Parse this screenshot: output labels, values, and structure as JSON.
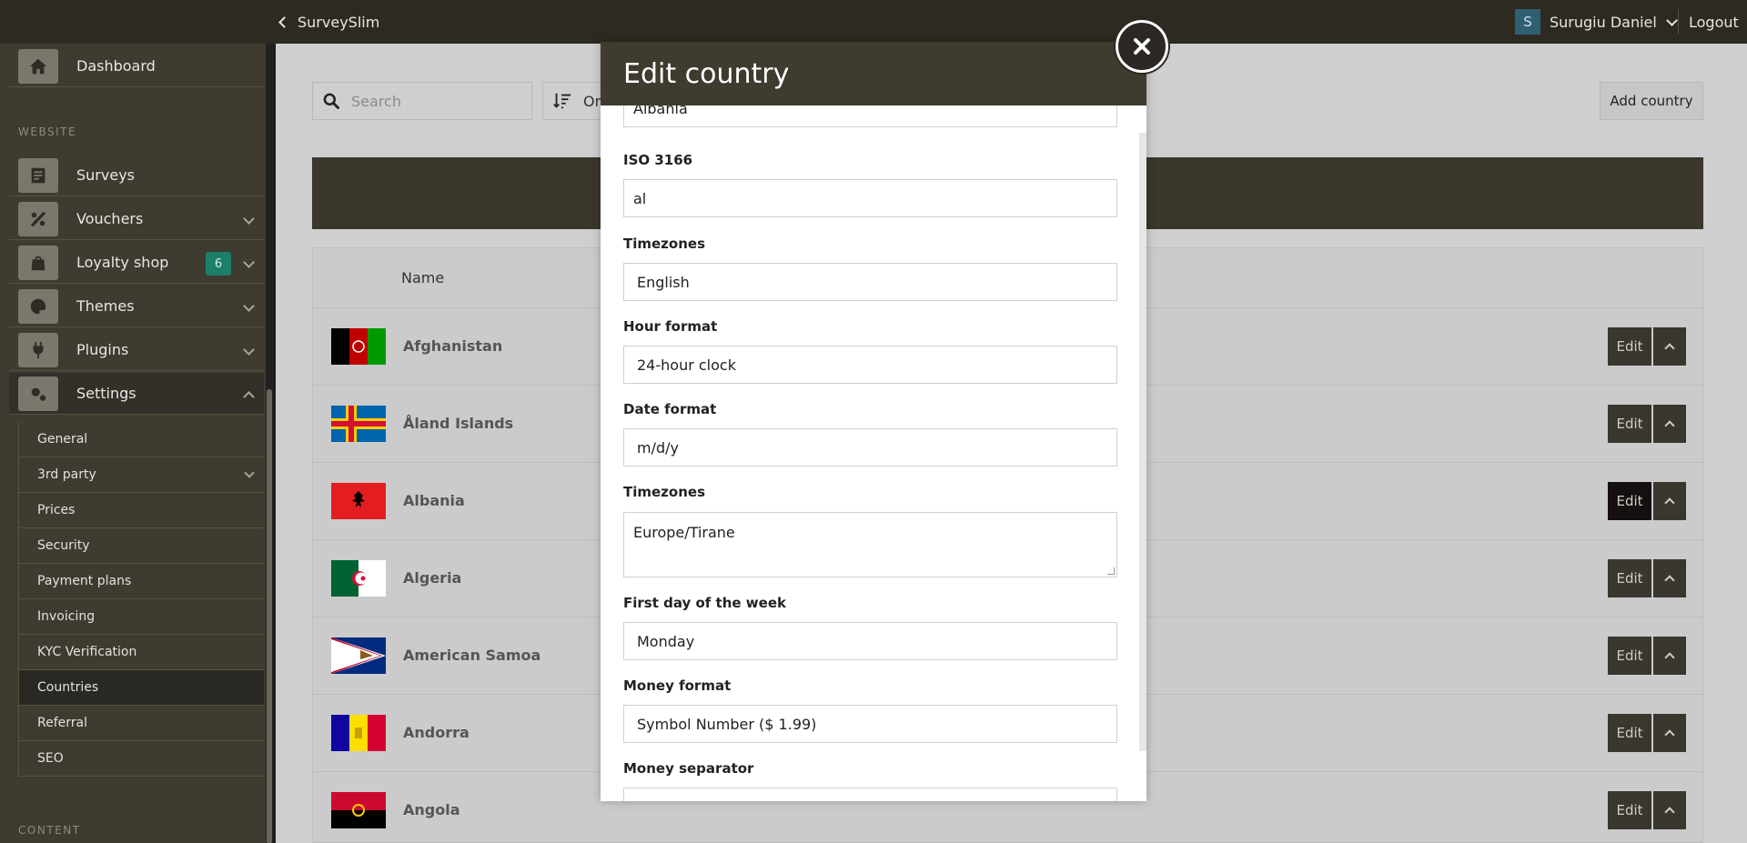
{
  "topbar": {
    "brand": "SurveySlim",
    "user_initial": "S",
    "user_name": "Surugiu Daniel",
    "logout": "Logout"
  },
  "sidebar": {
    "dashboard": "Dashboard",
    "section_website": "WEBSITE",
    "items": [
      {
        "label": "Surveys",
        "icon": "document-icon"
      },
      {
        "label": "Vouchers",
        "icon": "percent-icon"
      },
      {
        "label": "Loyalty shop",
        "icon": "shopping-bag-icon",
        "badge": "6"
      },
      {
        "label": "Themes",
        "icon": "palette-icon"
      },
      {
        "label": "Plugins",
        "icon": "plug-icon"
      },
      {
        "label": "Settings",
        "icon": "gears-icon"
      }
    ],
    "settings_sub": [
      "General",
      "3rd party",
      "Prices",
      "Security",
      "Payment plans",
      "Invoicing",
      "KYC Verification",
      "Countries",
      "Referral",
      "SEO"
    ],
    "section_content": "CONTENT"
  },
  "main": {
    "search_placeholder": "Search",
    "order_label": "Or",
    "add_country": "Add country",
    "column_name": "Name",
    "edit_label": "Edit",
    "countries": [
      "Afghanistan",
      "Åland Islands",
      "Albania",
      "Algeria",
      "American Samoa",
      "Andorra",
      "Angola"
    ]
  },
  "modal": {
    "title": "Edit country",
    "name_value": "Albania",
    "iso_label": "ISO 3166",
    "iso_value": "al",
    "languages_label": "Timezones",
    "languages_value": "English",
    "hour_label": "Hour format",
    "hour_value": "24-hour clock",
    "date_label": "Date format",
    "date_value": "m/d/y",
    "tz_label": "Timezones",
    "tz_value": "Europe/Tirane",
    "week_label": "First day of the week",
    "week_value": "Monday",
    "money_format_label": "Money format",
    "money_format_value": "Symbol Number ($ 1.99)",
    "money_sep_label": "Money separator"
  },
  "colors": {
    "topbar": "#2d2a22",
    "sidebar": "#3f3b30",
    "modal_header": "#3f3b2e",
    "badge": "#1c8069",
    "avatar": "#2f5f73"
  }
}
